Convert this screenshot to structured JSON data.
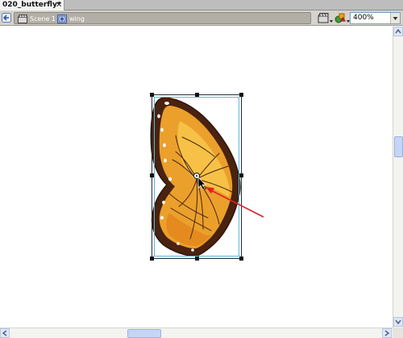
{
  "document_tab": {
    "title": "020_butterfly*",
    "close_glyph": "✕"
  },
  "edit_bar": {
    "back_icon": "arrow-left-icon",
    "breadcrumbs": [
      {
        "label": "Scene 1",
        "icon": "scene-clapper-icon"
      },
      {
        "label": "wing",
        "icon": "movieclip-symbol-icon"
      }
    ],
    "edit_scene_icon": "edit-scene-icon",
    "edit_symbols_icon": "edit-symbols-icon",
    "zoom": {
      "value": "400%"
    }
  },
  "stage": {
    "symbol": "wing",
    "wing_colors": {
      "outline": "#3b1a0e",
      "border": "#5a2a14",
      "fill_light": "#f6c146",
      "fill_mid": "#eba02c",
      "fill_dark": "#e58a1e",
      "vein": "#4a2410",
      "spots": "#ffffff"
    },
    "annotation_color": "#e02020",
    "selection_color": "#1e2a3a"
  },
  "colors": {
    "tab_strip": "#bdbdbd",
    "edit_bar": "#d6d3cc",
    "breadcrumb_bar": "#b2afa7",
    "scroll_thumb": "#c5d5f5"
  }
}
